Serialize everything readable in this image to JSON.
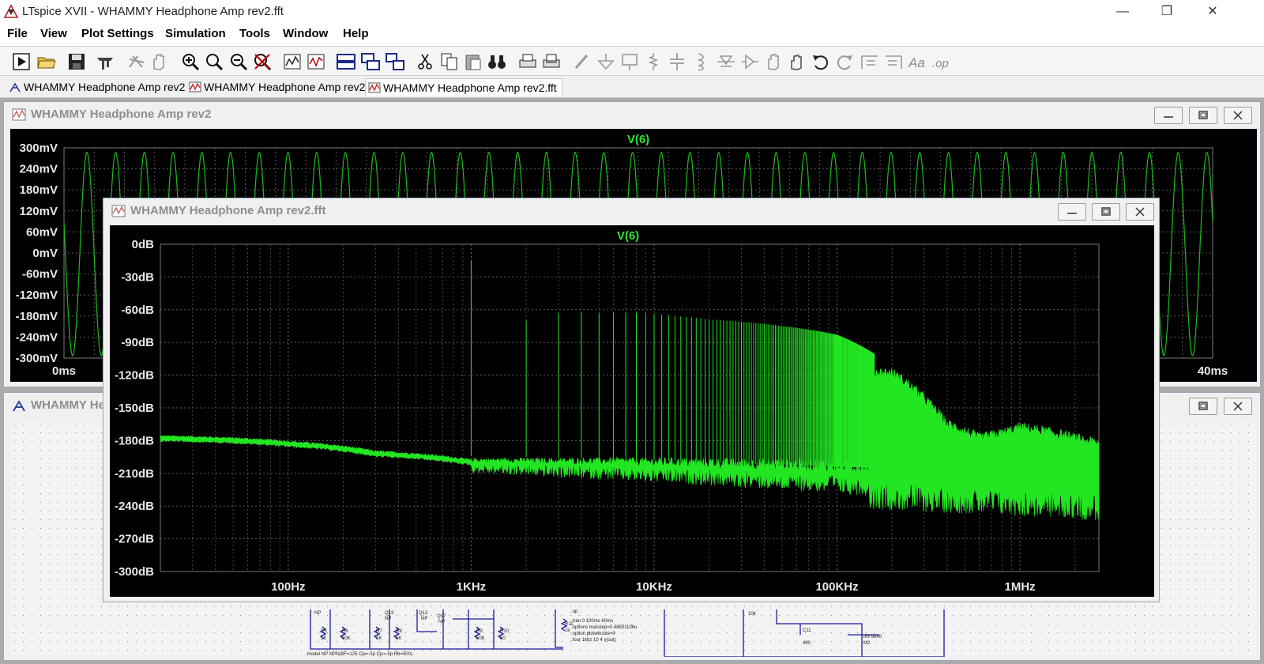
{
  "app": {
    "title": "LTspice XVII - WHAMMY Headphone Amp rev2.fft",
    "window_controls": {
      "minimize": "—",
      "restore": "❐",
      "close": "✕"
    }
  },
  "menu": [
    {
      "label": "File"
    },
    {
      "label": "View"
    },
    {
      "label": "Plot Settings"
    },
    {
      "label": "Simulation"
    },
    {
      "label": "Tools"
    },
    {
      "label": "Window"
    },
    {
      "label": "Help"
    }
  ],
  "toolbar": {
    "buttons": [
      "run-icon",
      "open-icon",
      "save-icon",
      "control-panel-icon",
      "halt-icon",
      "pan-icon",
      "zoom-in-icon",
      "zoom-area-icon",
      "zoom-out-icon",
      "zoom-cancel-icon",
      "autorange-icon",
      "add-trace-icon",
      "tile-horizontal-icon",
      "cascade-icon",
      "tile-vertical-icon",
      "cut-icon",
      "copy-icon",
      "paste-icon",
      "find-icon",
      "print-icon",
      "print-preview-icon",
      "draw-wire-icon",
      "ground-icon",
      "label-net-icon",
      "resistor-icon",
      "capacitor-icon",
      "inductor-icon",
      "diode-icon",
      "component-icon",
      "move-icon",
      "drag-icon",
      "undo-icon",
      "redo-icon",
      "rotate-icon",
      "mirror-icon",
      "text-icon",
      "spice-directive-icon"
    ]
  },
  "tabs": [
    {
      "label": "WHAMMY Headphone Amp rev2",
      "icon": "schematic-icon"
    },
    {
      "label": "WHAMMY Headphone Amp rev2",
      "icon": "waveform-icon"
    },
    {
      "label": "WHAMMY Headphone Amp rev2.fft",
      "icon": "waveform-icon",
      "active": true
    }
  ],
  "windows": {
    "transient": {
      "title": "WHAMMY Headphone Amp rev2"
    },
    "schematic": {
      "title": "WHAMMY He"
    },
    "fft": {
      "title": "WHAMMY Headphone Amp rev2.fft"
    }
  },
  "schematic_labels": {
    "directives": [
      ".tran 0 100ms 60ms",
      ".options maxstep=0.48831106u",
      ".option plotwinsize=0",
      ".four 1khz 10 4 v(out)",
      ".op"
    ],
    "model": ".model NP NPN(BF=125 Cje=.5p Cjc=.5p Rb=500)",
    "parts": [
      "R5",
      "1K",
      "R6",
      "50K",
      "R7",
      "1K",
      "R8",
      "5K",
      "Q13",
      "NP",
      "Q12",
      "NP",
      "Q17",
      "NP",
      "R9",
      "50K",
      "R10",
      "50",
      "R11",
      "1k",
      "10k",
      "C11",
      "490",
      "IRF9640",
      "M2",
      "NP"
    ]
  },
  "chart_data": [
    {
      "type": "line",
      "title": "V(6)",
      "x_unit": "ms",
      "y_unit": "mV",
      "xlim": [
        0,
        40
      ],
      "ylim": [
        -300,
        300
      ],
      "x_tick_labels": [
        "0ms",
        "40ms"
      ],
      "y_tick_labels": [
        "300mV",
        "240mV",
        "180mV",
        "120mV",
        "60mV",
        "0mV",
        "-60mV",
        "-120mV",
        "-180mV",
        "-240mV",
        "-300mV"
      ],
      "series": [
        {
          "name": "V(6)",
          "waveform": "sine",
          "frequency_hz": 1000,
          "amplitude_mV": 290,
          "offset_mV": -3,
          "color": "#1cbb1c"
        }
      ],
      "grid": true
    },
    {
      "type": "line",
      "title": "V(6)",
      "x_scale": "log",
      "xlim": [
        20,
        2700000
      ],
      "ylim": [
        -300,
        0
      ],
      "x_ticks": [
        100,
        1000,
        10000,
        100000,
        1000000
      ],
      "x_tick_labels": [
        "100Hz",
        "1KHz",
        "10KHz",
        "100KHz",
        "1MHz"
      ],
      "y_ticks": [
        0,
        -30,
        -60,
        -90,
        -120,
        -150,
        -180,
        -210,
        -240,
        -270,
        -300
      ],
      "y_tick_labels": [
        "0dB",
        "-30dB",
        "-60dB",
        "-90dB",
        "-120dB",
        "-150dB",
        "-180dB",
        "-210dB",
        "-240dB",
        "-270dB",
        "-300dB"
      ],
      "grid": true,
      "series": [
        {
          "name": "V(6)",
          "color": "#22e622",
          "noise_floor": {
            "x": [
              20,
              100,
              300,
              1000,
              3000,
              10000,
              30000,
              100000,
              300000,
              1000000,
              2700000
            ],
            "y": [
              -178,
              -183,
              -192,
              -200,
              -202,
              -204,
              -207,
              -210,
              -214,
              -218,
              -222
            ]
          },
          "harmonics": {
            "fundamental_hz": 1000,
            "x": [
              1000,
              2000,
              3000,
              4000,
              5000,
              6000,
              7000,
              8000,
              9000,
              10000,
              20000,
              50000,
              100000,
              200000
            ],
            "y": [
              -15,
              -70,
              -63,
              -62,
              -63,
              -62,
              -63,
              -63,
              -63,
              -64,
              -69,
              -75,
              -83,
              -112
            ]
          },
          "envelope_peak": {
            "x": [
              200000,
              400000,
              600000,
              1000000,
              2000000,
              2700000
            ],
            "y": [
              -118,
              -165,
              -178,
              -168,
              -178,
              -183
            ]
          }
        }
      ]
    }
  ]
}
